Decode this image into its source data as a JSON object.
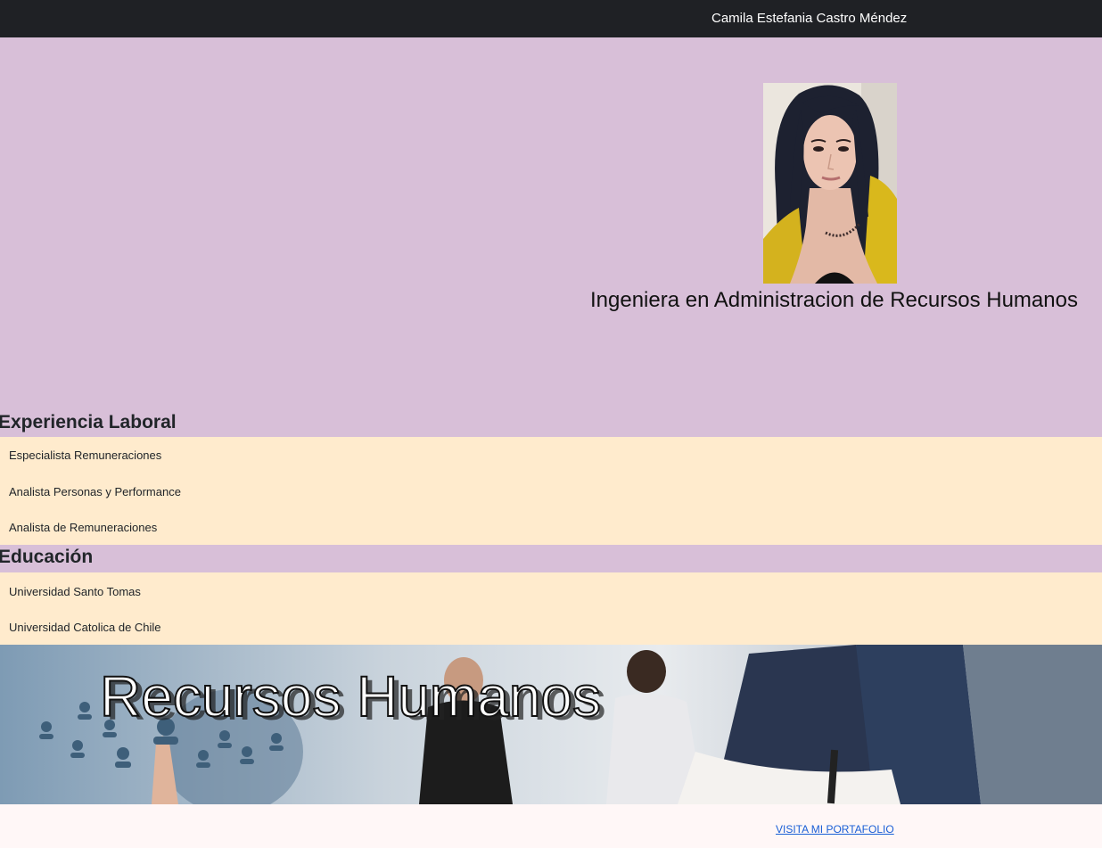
{
  "navbar": {
    "brand": "Camila Estefania Castro Méndez"
  },
  "hero": {
    "photo_icon": "profile-photo",
    "role": "Ingeniera en Administracion de Recursos Humanos"
  },
  "experience": {
    "title": "Experiencia Laboral",
    "items": [
      "Especialista Remuneraciones",
      "Analista Personas y Performance",
      "Analista de Remuneraciones"
    ]
  },
  "education": {
    "title": "Educación",
    "items": [
      "Universidad Santo Tomas",
      "Universidad Catolica de Chile"
    ]
  },
  "banner": {
    "text": "Recursos Humanos"
  },
  "footer": {
    "link": "VISITA MI PORTAFOLIO"
  },
  "colors": {
    "navbar": "#1f2125",
    "hero_bg": "#d8bfd8",
    "list_bg": "#ffebcd",
    "footer_bg": "#fff7f7",
    "link": "#1a5fd6"
  }
}
